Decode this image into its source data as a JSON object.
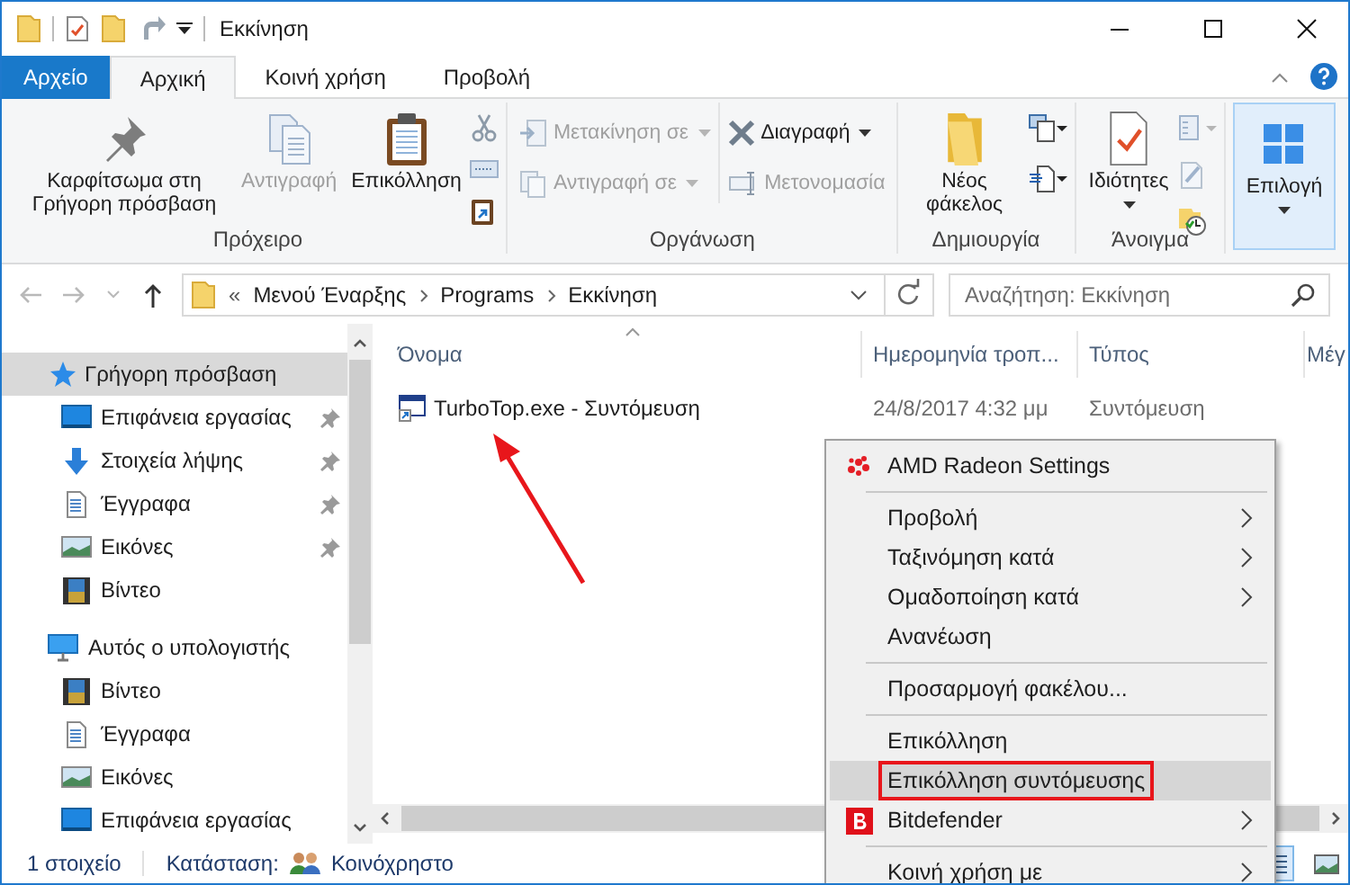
{
  "window": {
    "title": "Εκκίνηση"
  },
  "ribbon_tabs": [
    {
      "label": "Αρχείο",
      "kind": "file",
      "selected": false
    },
    {
      "label": "Αρχική",
      "kind": "tab",
      "selected": true
    },
    {
      "label": "Κοινή χρήση",
      "kind": "tab",
      "selected": false
    },
    {
      "label": "Προβολή",
      "kind": "tab",
      "selected": false
    }
  ],
  "ribbon_groups": [
    {
      "label": "Πρόχειρο",
      "items": [
        {
          "kind": "large",
          "label": "Καρφίτσωμα στη Γρήγορη πρόσβαση",
          "disabled": false,
          "dropdown": false,
          "pressed": false
        },
        {
          "kind": "large",
          "label": "Αντιγραφή",
          "disabled": true,
          "dropdown": false,
          "pressed": false
        },
        {
          "kind": "large",
          "label": "Επικόλληση",
          "disabled": false,
          "dropdown": false,
          "pressed": false
        }
      ]
    },
    {
      "label": "Οργάνωση",
      "items": [
        {
          "kind": "stack",
          "commands": [
            {
              "label": "Μετακίνηση σε",
              "disabled": true,
              "dropdown": true
            },
            {
              "label": "Αντιγραφή σε",
              "disabled": true,
              "dropdown": true
            }
          ]
        },
        {
          "kind": "stack",
          "commands": [
            {
              "label": "Διαγραφή",
              "disabled": false,
              "dropdown": true
            },
            {
              "label": "Μετονομασία",
              "disabled": true,
              "dropdown": false
            }
          ]
        }
      ]
    },
    {
      "label": "Δημιουργία",
      "items": [
        {
          "kind": "large",
          "label": "Νέος φάκελος",
          "disabled": false,
          "dropdown": false,
          "pressed": false
        }
      ]
    },
    {
      "label": "Άνοιγμα",
      "items": [
        {
          "kind": "large",
          "label": "Ιδιότητες",
          "disabled": false,
          "dropdown": true,
          "pressed": false
        }
      ]
    },
    {
      "items": [
        {
          "kind": "large",
          "label": "Επιλογή",
          "disabled": false,
          "dropdown": true,
          "pressed": true
        }
      ]
    }
  ],
  "address": {
    "overflow": "«",
    "segments": [
      "Μενού Έναρξης",
      "Programs",
      "Εκκίνηση"
    ]
  },
  "search": {
    "placeholder": "Αναζήτηση: Εκκίνηση"
  },
  "nav": [
    {
      "label": "Γρήγορη πρόσβαση",
      "kind": "star",
      "selected": true,
      "children": [
        {
          "label": "Επιφάνεια εργασίας",
          "kind": "desktop",
          "pinned": true,
          "selected": false
        },
        {
          "label": "Στοιχεία λήψης",
          "kind": "download",
          "pinned": true,
          "selected": false
        },
        {
          "label": "Έγγραφα",
          "kind": "document",
          "pinned": true,
          "selected": false
        },
        {
          "label": "Εικόνες",
          "kind": "pictures",
          "pinned": true,
          "selected": false
        },
        {
          "label": "Βίντεο",
          "kind": "video",
          "pinned": false,
          "selected": false
        }
      ]
    },
    {
      "label": "Αυτός ο υπολογιστής",
      "kind": "computer",
      "selected": false,
      "children": [
        {
          "label": "Βίντεο",
          "kind": "video",
          "pinned": false,
          "selected": false
        },
        {
          "label": "Έγγραφα",
          "kind": "document",
          "pinned": false,
          "selected": false
        },
        {
          "label": "Εικόνες",
          "kind": "pictures",
          "pinned": false,
          "selected": false
        },
        {
          "label": "Επιφάνεια εργασίας",
          "kind": "desktop",
          "pinned": false,
          "selected": false
        }
      ]
    }
  ],
  "table": {
    "columns": [
      "Όνομα",
      "Ημερομηνία τροπ...",
      "Τύπος",
      "Μέγ"
    ],
    "rows": [
      {
        "cells": [
          "TurboTop.exe - Συντόμευση",
          "24/8/2017 4:32 μμ",
          "Συντόμευση"
        ]
      }
    ]
  },
  "status_bar": {
    "count": "1 στοιχείο",
    "state_label": "Κατάσταση:",
    "state_value": "Κοινόχρηστο"
  },
  "context_menu": [
    {
      "kind": "amd",
      "label": "AMD Radeon Settings",
      "submenu": false,
      "selected": false,
      "outlined": false
    },
    {
      "kind": "separator"
    },
    {
      "kind": "plain",
      "label": "Προβολή",
      "submenu": true,
      "selected": false,
      "outlined": false
    },
    {
      "kind": "plain",
      "label": "Ταξινόμηση κατά",
      "submenu": true,
      "selected": false,
      "outlined": false
    },
    {
      "kind": "plain",
      "label": "Ομαδοποίηση κατά",
      "submenu": true,
      "selected": false,
      "outlined": false
    },
    {
      "kind": "plain",
      "label": "Ανανέωση",
      "submenu": false,
      "selected": false,
      "outlined": false
    },
    {
      "kind": "separator"
    },
    {
      "kind": "plain",
      "label": "Προσαρμογή φακέλου...",
      "submenu": false,
      "selected": false,
      "outlined": false
    },
    {
      "kind": "separator"
    },
    {
      "kind": "plain",
      "label": "Επικόλληση",
      "submenu": false,
      "selected": false,
      "outlined": false
    },
    {
      "kind": "plain",
      "label": "Επικόλληση συντόμευσης",
      "submenu": false,
      "selected": true,
      "outlined": true
    },
    {
      "kind": "bitdefender",
      "label": "Bitdefender",
      "submenu": true,
      "selected": false,
      "outlined": false
    },
    {
      "kind": "separator"
    },
    {
      "kind": "plain",
      "label": "Κοινή χρήση με",
      "submenu": true,
      "selected": false,
      "outlined": false
    }
  ]
}
